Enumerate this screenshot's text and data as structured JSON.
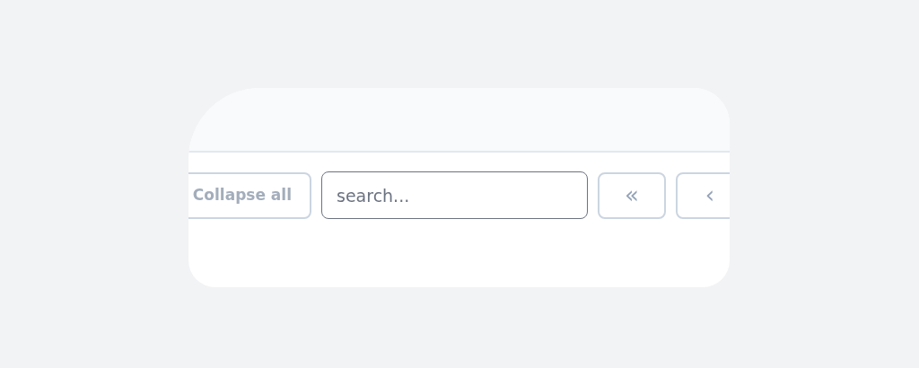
{
  "toolbar": {
    "collapse_button": "Collapse all",
    "search": {
      "placeholder": "search..."
    },
    "pager_buttons": [
      "«",
      "‹"
    ]
  }
}
